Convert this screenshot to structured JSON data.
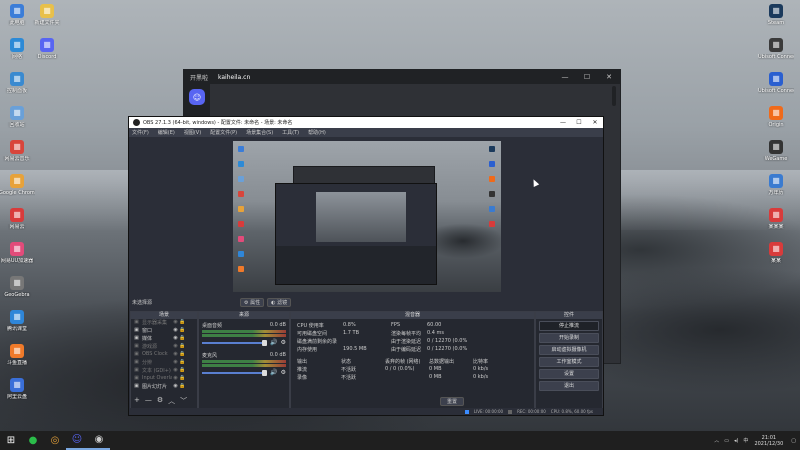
{
  "desktop": {
    "left_icons": [
      {
        "label": "此电脑",
        "icon": "computer-icon",
        "color": "#3b7dd8"
      },
      {
        "label": "网络",
        "icon": "network-icon",
        "color": "#2d8ad6"
      },
      {
        "label": "控制面板",
        "icon": "control-panel-icon",
        "color": "#3a8ad0"
      },
      {
        "label": "回收站",
        "icon": "recycle-bin-icon",
        "color": "#6aa0d8"
      },
      {
        "label": "网易云音乐",
        "icon": "music-icon",
        "color": "#d8453b"
      },
      {
        "label": "Google Chrome",
        "icon": "chrome-icon",
        "color": "#e7a23a"
      },
      {
        "label": "网易云",
        "icon": "app-icon",
        "color": "#d83b3b"
      },
      {
        "label": "网易UU加速器",
        "icon": "accelerator-icon",
        "color": "#e24b7a"
      },
      {
        "label": "GeoGebra",
        "icon": "geogebra-icon",
        "color": "#777"
      },
      {
        "label": "腾讯课堂",
        "icon": "class-icon",
        "color": "#2f86d8"
      },
      {
        "label": "斗鱼直播",
        "icon": "live-icon",
        "color": "#f07a2a"
      },
      {
        "label": "阿里云盘",
        "icon": "cloud-icon",
        "color": "#3a6fd8"
      }
    ],
    "left_icons_col2": [
      {
        "label": "新建文件夹",
        "icon": "folder-icon",
        "color": "#e8c04a"
      },
      {
        "label": "Discord",
        "icon": "discord-icon",
        "color": "#5865f2"
      }
    ],
    "right_icons": [
      {
        "label": "Steam",
        "icon": "steam-icon",
        "color": "#1b3a5c"
      },
      {
        "label": "Ubisoft Connect",
        "icon": "ubisoft-icon",
        "color": "#3a3a3a"
      },
      {
        "label": "Ubisoft Connect",
        "icon": "ubisoft-icon",
        "color": "#2a5fd0"
      },
      {
        "label": "Origin",
        "icon": "origin-icon",
        "color": "#f06a1a"
      },
      {
        "label": "WeGame",
        "icon": "wegame-icon",
        "color": "#333"
      },
      {
        "label": "万年历",
        "icon": "calendar-icon",
        "color": "#3a7bd0"
      },
      {
        "label": "某某某",
        "icon": "app-icon",
        "color": "#d83b3b"
      },
      {
        "label": "某某",
        "icon": "app-icon",
        "color": "#d83b3b"
      }
    ]
  },
  "discord": {
    "title": "开黑啦",
    "subtitle": "kaiheila.cn"
  },
  "obs": {
    "title": "OBS 27.1.3 (64-bit, windows) - 配置文件: 未命名 - 场景: 未命名",
    "menu": [
      "文件(F)",
      "编辑(E)",
      "视图(V)",
      "配置文件(P)",
      "场景集合(S)",
      "工具(T)",
      "帮助(H)"
    ],
    "source_bar_label": "未选择源",
    "filter_buttons": [
      "属性",
      "滤镜"
    ],
    "docks": {
      "scenes": "场景",
      "sources": "来源",
      "mixer": "混音器",
      "stats": "统计",
      "controls": "控件"
    },
    "sources": [
      {
        "name": "显示器采集",
        "icon": "monitor-icon",
        "dim": true
      },
      {
        "name": "窗口",
        "icon": "window-icon",
        "dim": false
      },
      {
        "name": "媒体",
        "icon": "media-icon",
        "dim": false
      },
      {
        "name": "游戏源",
        "icon": "game-icon",
        "dim": true
      },
      {
        "name": "OBS Clock",
        "icon": "clock-icon",
        "dim": true
      },
      {
        "name": "分辨",
        "icon": "image-icon",
        "dim": true
      },
      {
        "name": "文本 (GDI+)",
        "icon": "text-icon",
        "dim": true
      },
      {
        "name": "Input Overla",
        "icon": "input-icon",
        "dim": true
      },
      {
        "name": "图片幻灯片",
        "icon": "slideshow-icon",
        "dim": false
      }
    ],
    "mixer": [
      {
        "name": "桌面音频",
        "db": "0.0 dB"
      },
      {
        "name": "麦克风",
        "db": "0.0 dB"
      }
    ],
    "stats": {
      "rows": [
        [
          "CPU 使用率",
          "0.8%",
          "FPS",
          "60.00"
        ],
        [
          "可用磁盘空间",
          "1.7 TB",
          "渲染每帧平均时间",
          "0.4 ms"
        ],
        [
          "磁盘满前剩余的录制时长(约)",
          "",
          "由于渲染延迟而跳过的帧",
          "0 / 12270 (0.0%)"
        ],
        [
          "内存使用",
          "190.5 MB",
          "由于编码延迟而跳过的帧",
          "0 / 12270 (0.0%)"
        ]
      ],
      "output_headers": [
        "输出",
        "状态",
        "丢弃的帧 (网络)",
        "总数据输出",
        "比特率"
      ],
      "outputs": [
        [
          "推流",
          "不活跃",
          "0 / 0 (0.0%)",
          "0 MB",
          "0 kb/s"
        ],
        [
          "录像",
          "不活跃",
          "",
          "0 MB",
          "0 kb/s"
        ]
      ],
      "reset_label": "重置"
    },
    "controls": [
      "停止推流",
      "开始录制",
      "启动虚拟摄像机",
      "工作室模式",
      "设置",
      "退出"
    ],
    "status": [
      "LIVE: 00:00:00",
      "REC: 00:00:00",
      "CPU: 0.8%, 60.00 fps"
    ]
  },
  "taskbar": {
    "apps": [
      "start-icon",
      "wechat-icon",
      "chrome-icon",
      "discord-icon",
      "obs-icon"
    ],
    "time": "21:01",
    "date": "2021/12/30",
    "lang": "中"
  }
}
